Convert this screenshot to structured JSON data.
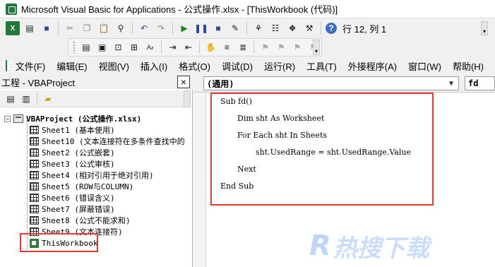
{
  "window": {
    "title": "Microsoft Visual Basic for Applications - 公式操作.xlsx - [ThisWorkbook (代码)]"
  },
  "toolbar": {
    "position_readout": "行 12, 列 1",
    "icons": [
      "view-excel-icon",
      "insert-module-icon",
      "save-icon",
      "cut-icon",
      "copy-icon",
      "paste-icon",
      "find-icon",
      "undo-icon",
      "redo-icon",
      "run-icon",
      "break-icon",
      "reset-icon",
      "design-mode-icon",
      "project-explorer-icon",
      "properties-icon",
      "object-browser-icon",
      "toolbox-icon",
      "help-icon"
    ]
  },
  "edit_toolbar": {
    "icons": [
      "list-properties-icon",
      "list-constants-icon",
      "quick-info-icon",
      "parameter-info-icon",
      "complete-word-icon",
      "indent-icon",
      "outdent-icon",
      "toggle-breakpoint-icon",
      "comment-block-icon",
      "uncomment-block-icon",
      "toggle-bookmark-icon",
      "next-bookmark-icon",
      "previous-bookmark-icon",
      "clear-bookmarks-icon"
    ]
  },
  "menu": {
    "items": [
      "文件(F)",
      "编辑(E)",
      "视图(V)",
      "插入(I)",
      "格式(O)",
      "调试(D)",
      "运行(R)",
      "工具(T)",
      "外接程序(A)",
      "窗口(W)",
      "帮助(H)"
    ]
  },
  "project": {
    "title": "工程 - VBAProject",
    "close_label": "×",
    "root": "VBAProject (公式操作.xlsx)",
    "sheets": [
      "Sheet1 (基本使用)",
      "Sheet10 (文本连接符在多条件查找中的",
      "Sheet2 (公式嵌套)",
      "Sheet3 (公式审核)",
      "Sheet4 (相对引用于绝对引用)",
      "Sheet5 (ROW与COLUMN)",
      "Sheet6 (错误含义)",
      "Sheet7 (屏蔽错误)",
      "Sheet8 (公式不能求和)",
      "Sheet9 (文本连接符)"
    ],
    "workbook": "ThisWorkbook"
  },
  "code": {
    "object": "(通用)",
    "procedure": "fd",
    "lines": [
      "Sub fd()",
      "Dim sht As Worksheet",
      "For Each sht In Sheets",
      "sht.UsedRange = sht.UsedRange.Value",
      "Next",
      "End Sub"
    ]
  },
  "watermark": {
    "logo": "R",
    "text": "热搜下载"
  }
}
